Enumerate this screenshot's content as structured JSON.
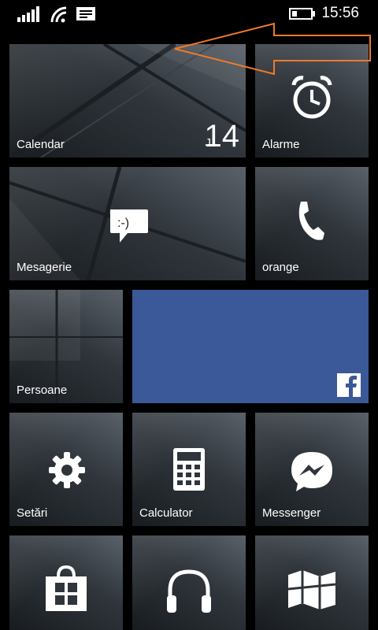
{
  "status_bar": {
    "time": "15:56",
    "icons": [
      "signal-icon",
      "wifi-icon",
      "message-icon",
      "battery-icon"
    ]
  },
  "tiles": {
    "calendar": {
      "label": "Calendar",
      "day_letter": "J",
      "day_number": "14"
    },
    "alarms": {
      "label": "Alarme",
      "icon": "alarm-clock-icon"
    },
    "messaging": {
      "label": "Mesagerie",
      "icon": "chat-bubble-icon",
      "emoticon": ":-)"
    },
    "phone": {
      "label": "orange",
      "icon": "phone-icon"
    },
    "people": {
      "label": "Persoane"
    },
    "facebook": {
      "icon": "facebook-icon",
      "color": "#3b5998"
    },
    "settings": {
      "label": "Setări",
      "icon": "gear-icon"
    },
    "calculator": {
      "label": "Calculator",
      "icon": "calculator-icon"
    },
    "messenger": {
      "label": "Messenger",
      "icon": "messenger-icon"
    },
    "store": {
      "icon": "store-icon"
    },
    "music": {
      "icon": "headphones-icon"
    },
    "maps": {
      "icon": "map-icon"
    }
  },
  "annotation": {
    "arrow_color": "#f07a2a"
  }
}
